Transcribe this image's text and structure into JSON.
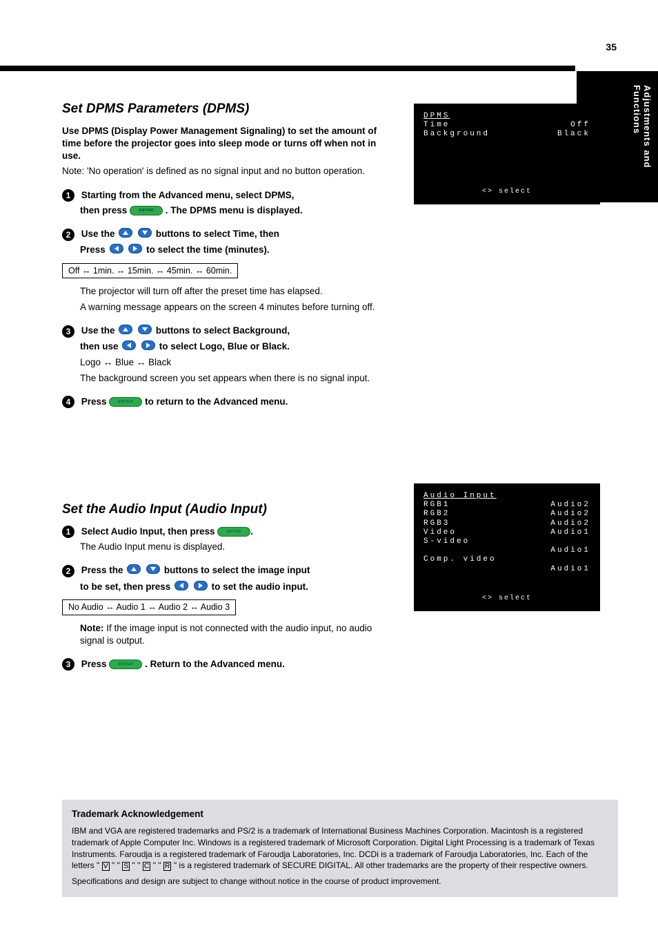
{
  "page_number": "35",
  "side_tab": "Adjustments and Functions",
  "sections": {
    "dpms": {
      "heading": "Set DPMS Parameters (DPMS)",
      "intro_bold": "Use DPMS (Display Power Management Signaling) to set the amount of time before the projector goes into sleep mode or turns off when not in use.",
      "note": "Note: 'No operation' is defined as no signal input and no button operation.",
      "step1_label": "1",
      "step1": "Starting from the Advanced menu, select DPMS,",
      "step1_then": "then press ",
      "step1_after": ". The DPMS menu is displayed.",
      "step2_label": "2",
      "step2a": "Use the  ",
      "step2b": " buttons to select Time, then",
      "step2c": "Press  ",
      "step2d": " to select the time (minutes).",
      "cycle_time": "Off ↔ 1min. ↔ 15min. ↔ 45min. ↔ 60min.",
      "time_foot_a": "The projector will turn off after the preset time has elapsed.",
      "time_foot_b": "A warning message appears on the screen 4 minutes before turning off.",
      "step3_label": "3",
      "step3a": "Use the  ",
      "step3b": " buttons to select Background,",
      "step3c": "then use  ",
      "step3d": " to select Logo, Blue or Black.",
      "bg_row": "Logo ↔ Blue ↔ Black",
      "bg_foot": "The background screen you set appears when there is no signal input.",
      "step4_label": "4",
      "step4": "Press  ",
      "step4_after": " to return to the Advanced menu."
    },
    "audio": {
      "heading": "Set the Audio Input (Audio Input)",
      "step1_label": "1",
      "step1a": "Select Audio Input, then press ",
      "step1b": "The Audio Input menu is displayed.",
      "step2_label": "2",
      "step2a": "Press the  ",
      "step2b": " buttons to select the image input",
      "step2c": "to be set, then press  ",
      "step2d": " to set the audio input.",
      "cycle_audio": "No Audio ↔ Audio 1 ↔ Audio 2 ↔ Audio 3",
      "note_title": "Note:",
      "note_body": "If the image input is not connected with the audio input, no audio signal is output.",
      "step3_label": "3",
      "step3a": "Press  ",
      "step3b": ". Return to the Advanced menu."
    }
  },
  "osd_dpms": {
    "title": "DPMS",
    "rows": [
      {
        "label": "Time",
        "value": "Off"
      },
      {
        "label": "Background",
        "value": "Black"
      }
    ],
    "footer": "<>  select"
  },
  "osd_audio": {
    "title": "Audio Input",
    "rows": [
      {
        "label": "RGB1",
        "value": "Audio2"
      },
      {
        "label": "RGB2",
        "value": "Audio2"
      },
      {
        "label": "RGB3",
        "value": "Audio2"
      },
      {
        "label": "Video",
        "value": "Audio1"
      },
      {
        "label": "S-video",
        "value": ""
      },
      {
        "label": "",
        "value": "Audio1"
      },
      {
        "label": "Comp. video",
        "value": ""
      },
      {
        "label": "",
        "value": "Audio1"
      }
    ],
    "footer": "<>  select"
  },
  "trademark": {
    "title": "Trademark Acknowledgement",
    "line1_pre": "IBM and VGA are registered trademarks and PS/2 is a trademark of International Business Machines Corporation. Macintosh is a registered trademark of Apple Computer Inc. Windows is a registered trademark of Microsoft Corporation. Digital Light Processing is a trademark of Texas Instruments. Faroudja is a registered trademark of Faroudja Laboratories, Inc. DCDi is a trademark of Faroudja Laboratories, Inc. Each of the letters \"",
    "v": "V",
    "mid1": "\" \"",
    "s": "S",
    "mid2": "\" \"",
    "c": "C",
    "mid3": "\" \"",
    "r": "R",
    "line1_post": "\" is a registered trademark of SECURE DIGITAL. All other trademarks are the property of their respective owners.",
    "line2": "Specifications and design are subject to change without notice in the course of product improvement."
  }
}
